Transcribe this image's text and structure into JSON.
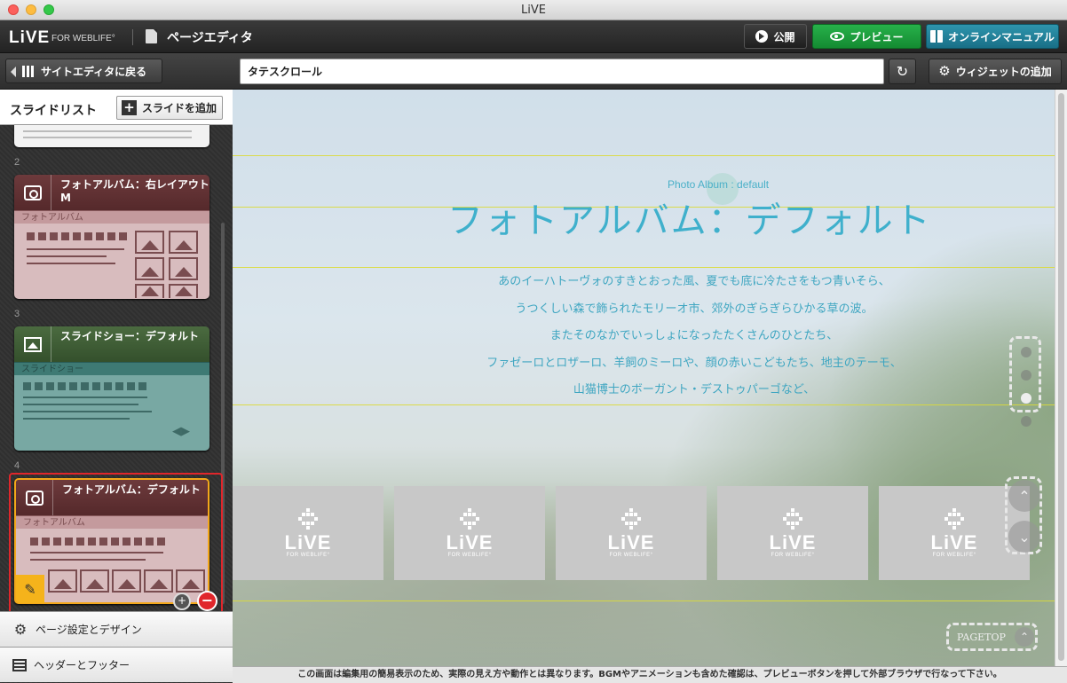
{
  "window": {
    "title": "LiVE"
  },
  "header": {
    "logo": "LiVE",
    "logo_sub": "FOR WEBLIFE°",
    "app_name": "ページエディタ",
    "publish_label": "公開",
    "preview_label": "プレビュー",
    "manual_label": "オンラインマニュアル"
  },
  "toolbar": {
    "back_label": "サイトエディタに戻る",
    "page_title_value": "タテスクロール",
    "widget_label": "ウィジェットの追加"
  },
  "sidebar": {
    "title": "スライドリスト",
    "add_slide_label": "スライドを追加",
    "slides": [
      {
        "num": "2",
        "title": "フォトアルバム：右レイアウトM",
        "sub": "フォトアルバム"
      },
      {
        "num": "3",
        "title": "スライドショー：デフォルト",
        "sub": "スライドショー"
      },
      {
        "num": "4",
        "title": "フォトアルバム：デフォルト",
        "sub": "フォトアルバム"
      }
    ],
    "page_settings_label": "ページ設定とデザイン",
    "header_footer_label": "ヘッダーとフッター"
  },
  "canvas": {
    "widget_label": "Photo Album : default",
    "title": "フォトアルバム：デフォルト",
    "lines": [
      "あのイーハトーヴォのすきとおった風、夏でも底に冷たさをもつ青いそら、",
      "うつくしい森で飾られたモリーオ市、郊外のぎらぎらひかる草の波。",
      "またそのなかでいっしょになったたくさんのひとたち、",
      "ファゼーロとロザーロ、羊飼のミーロや、顔の赤いこどもたち、地主のテーモ、",
      "山猫博士のボーガント・デストゥパーゴなど、"
    ],
    "thumb_logo": "LiVE",
    "thumb_sub": "FOR WEBLIFE°",
    "pagetop_label": "PAGETOP"
  },
  "footnote": "この画面は編集用の簡易表示のため、実際の見え方や動作とは異なります。BGMやアニメーションも含めた確認は、プレビューボタンを押して外部ブラウザで行なって下さい。",
  "colors": {
    "preview": "#1a9e3d",
    "manual": "#1f7f97",
    "accent_title": "#3fb0cc",
    "selection": "#e0262b"
  }
}
